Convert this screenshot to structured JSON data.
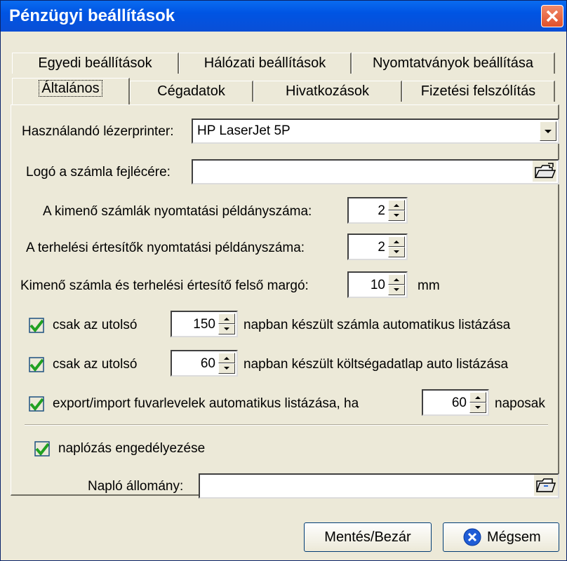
{
  "window": {
    "title": "Pénzügyi beállítások"
  },
  "tabs_row1": [
    "Egyedi beállítások",
    "Hálózati beállítások",
    "Nyomtatványok beállítása"
  ],
  "tabs_row2": [
    "Általános",
    "Cégadatok",
    "Hivatkozások",
    "Fizetési felszólítás"
  ],
  "form": {
    "printer_label": "Használandó lézerprinter:",
    "printer_value": "HP LaserJet 5P",
    "logo_label": "Logó a számla fejlécére:",
    "logo_value": "",
    "copies_out_label": "A kimenő számlák nyomtatási példányszáma:",
    "copies_out_value": "2",
    "copies_debit_label": "A terhelési értesítők nyomtatási példányszáma:",
    "copies_debit_value": "2",
    "margin_label": "Kimenő számla és terhelési értesítő felső margó:",
    "margin_value": "10",
    "margin_unit": "mm",
    "invoice_days_prefix": "csak az utolsó",
    "invoice_days_value": "150",
    "invoice_days_suffix": "napban készült számla automatikus listázása",
    "cost_days_prefix": "csak az utolsó",
    "cost_days_value": "60",
    "cost_days_suffix": "napban készült költségadatlap auto listázása",
    "export_label": "export/import fuvarlevelek automatikus listázása, ha",
    "export_value": "60",
    "export_suffix": "naposak",
    "logging_label": "naplózás engedélyezése",
    "logfile_label": "Napló állomány:",
    "logfile_value": ""
  },
  "buttons": {
    "save": "Mentés/Bezár",
    "cancel": "Mégsem"
  },
  "colors": {
    "title_bar": "#0054e3",
    "face": "#ece9d8",
    "check": "#21a121"
  }
}
